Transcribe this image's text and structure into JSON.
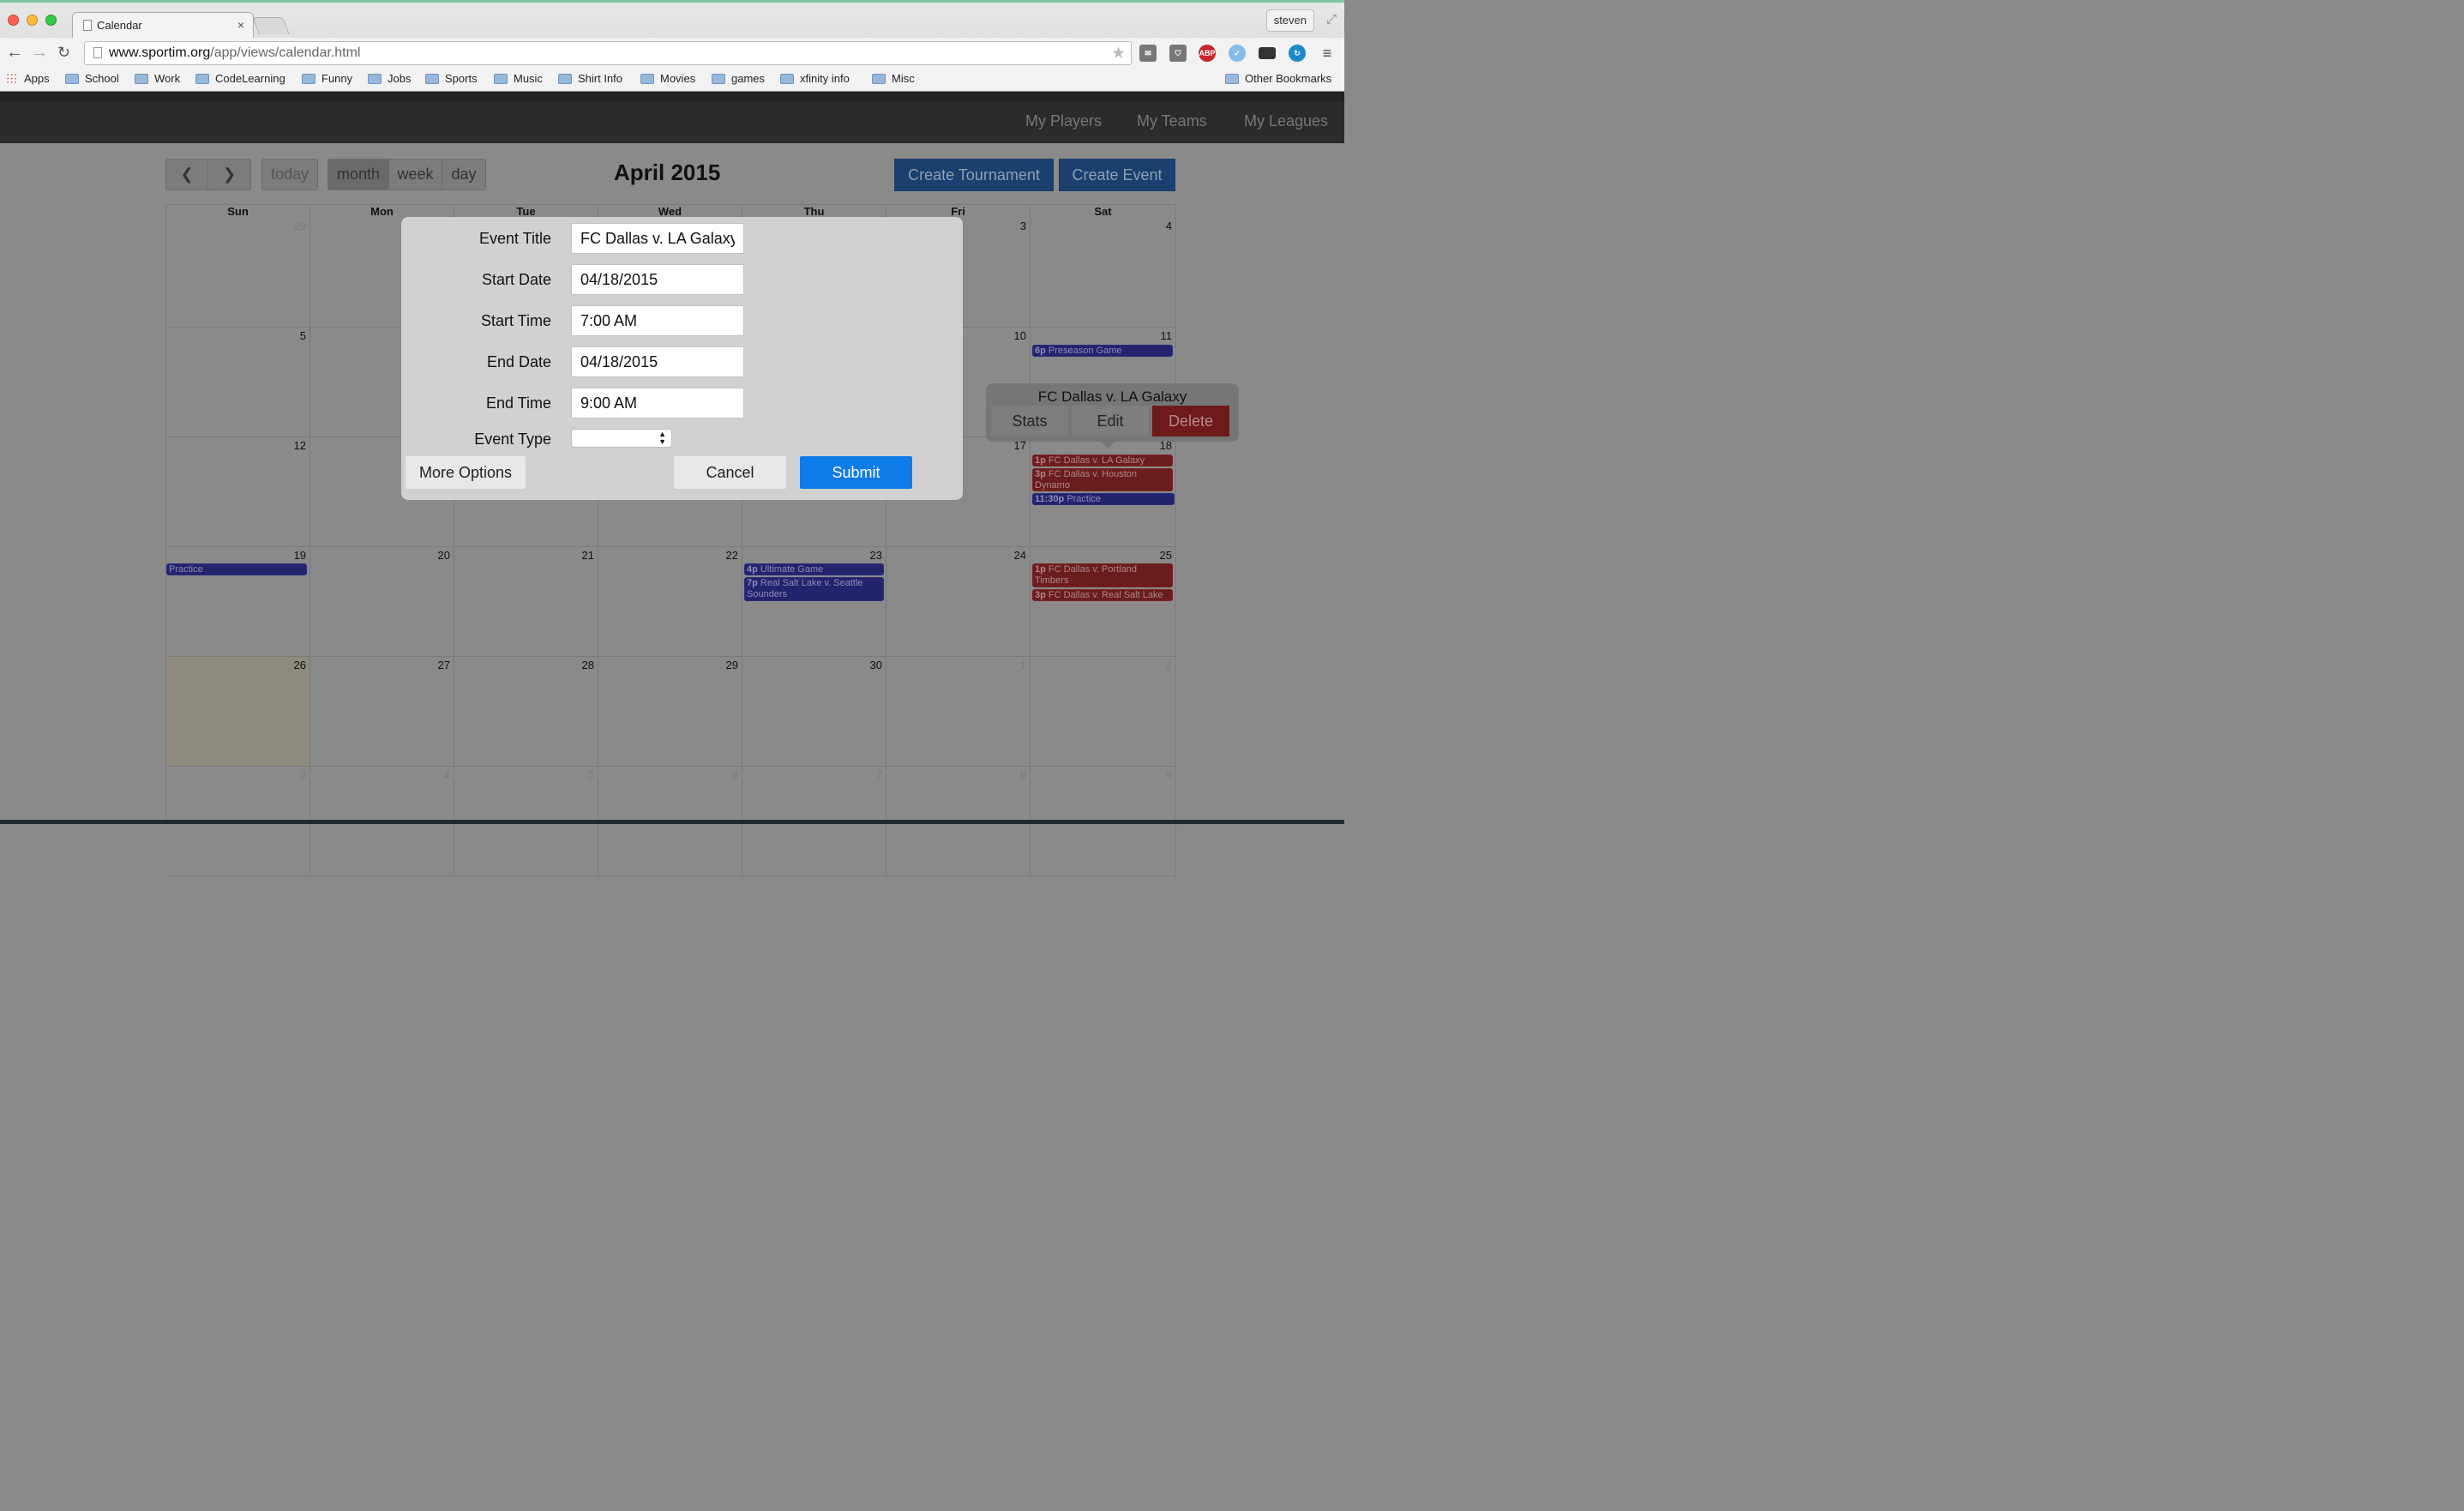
{
  "browser": {
    "tab_title": "Calendar",
    "tab_close": "×",
    "user": "steven",
    "url_host": "www.sportim.org",
    "url_path": "/app/views/calendar.html",
    "bookmarks": [
      "Apps",
      "School",
      "Work",
      "CodeLearning",
      "Funny",
      "Jobs",
      "Sports",
      "Music",
      "Shirt Info",
      "Movies",
      "games",
      "xfinity info",
      "Misc"
    ],
    "other_bookmarks": "Other Bookmarks",
    "extensions": [
      "mail-icon",
      "pocket-icon",
      "adblock-icon",
      "vimeo-icon",
      "terminal-icon",
      "sync-icon",
      "menu-icon"
    ],
    "abp_label": "ABP"
  },
  "app_nav": {
    "players": "My Players",
    "teams": "My Teams",
    "leagues": "My Leagues"
  },
  "calendar": {
    "title": "April 2015",
    "prev": "‹",
    "next": "›",
    "today": "today",
    "views": [
      "month",
      "week",
      "day"
    ],
    "active_view": "month",
    "create_tournament": "Create Tournament",
    "create_event": "Create Event",
    "weekdays": [
      "Sun",
      "Mon",
      "Tue",
      "Wed",
      "Thu",
      "Fri",
      "Sat"
    ],
    "weeks": [
      [
        "29",
        "",
        "",
        "",
        "",
        "3",
        "4"
      ],
      [
        "5",
        "",
        "",
        "",
        "",
        "10",
        "11"
      ],
      [
        "12",
        "",
        "",
        "",
        "",
        "17",
        "18"
      ],
      [
        "19",
        "20",
        "21",
        "22",
        "23",
        "24",
        "25"
      ],
      [
        "26",
        "27",
        "28",
        "29",
        "30",
        "1",
        "2"
      ],
      [
        "3",
        "4",
        "5",
        "6",
        "7",
        "8",
        "9"
      ]
    ],
    "events": {
      "sat11": {
        "time": "6p",
        "title": "Preseason Game"
      },
      "sat18a": {
        "time": "1p",
        "title": "FC Dallas v. LA Galaxy"
      },
      "sat18b": {
        "time": "3p",
        "title": "FC Dallas v. Houston Dynamo"
      },
      "sat18c": {
        "time": "11:30p",
        "title": "Practice"
      },
      "sun19": {
        "title": "Practice"
      },
      "thu23a": {
        "time": "4p",
        "title": "Ultimate Game"
      },
      "thu23b": {
        "time": "7p",
        "title": "Real Salt Lake v. Seattle Sounders"
      },
      "sat25a": {
        "time": "1p",
        "title": "FC Dallas v. Portland Timbers"
      },
      "sat25b": {
        "time": "3p",
        "title": "FC Dallas v. Real Salt Lake"
      }
    },
    "colors": {
      "blue_event": "#23236e",
      "red_event": "#6b1d1d",
      "primary": "#0f7be8",
      "create_btn": "#1b3f6e"
    }
  },
  "popover": {
    "title": "FC Dallas v. LA Galaxy",
    "stats": "Stats",
    "edit": "Edit",
    "delete": "Delete"
  },
  "modal": {
    "event_title_label": "Event Title",
    "event_title_value": "FC Dallas v. LA Galaxy",
    "start_date_label": "Start Date",
    "start_date_value": "04/18/2015",
    "start_time_label": "Start Time",
    "start_time_value": "7:00 AM",
    "end_date_label": "End Date",
    "end_date_value": "04/18/2015",
    "end_time_label": "End Time",
    "end_time_value": "9:00 AM",
    "event_type_label": "Event Type",
    "event_type_value": "",
    "more_options": "More Options",
    "cancel": "Cancel",
    "submit": "Submit"
  }
}
